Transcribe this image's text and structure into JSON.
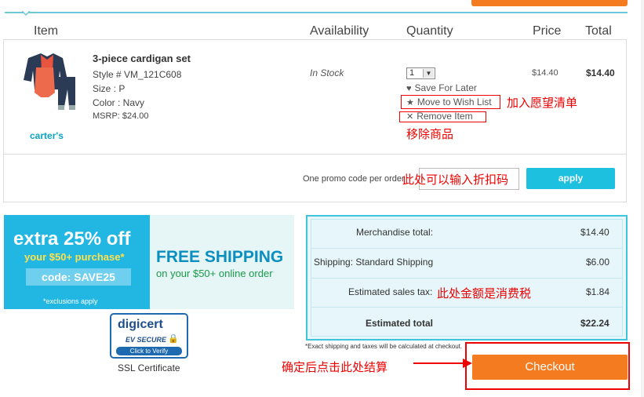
{
  "table_headers": {
    "item": "Item",
    "availability": "Availability",
    "quantity": "Quantity",
    "price": "Price",
    "total": "Total"
  },
  "product": {
    "brand": "carter's",
    "name": "3-piece cardigan set",
    "style": "Style # VM_121C608",
    "size": "Size : P",
    "color": "Color : Navy",
    "msrp": "MSRP: $24.00",
    "availability": "In Stock",
    "quantity": "1",
    "price": "$14.40",
    "total": "$14.40"
  },
  "actions": {
    "save_for_later": "Save For Later",
    "move_to_wish_list": "Move to Wish List",
    "remove_item": "Remove Item"
  },
  "annotations": {
    "wish_list": "加入愿望清单",
    "remove": "移除商品",
    "promo": "此处可以输入折扣码",
    "tax": "此处金额是消费税",
    "checkout": "确定后点击此处结算"
  },
  "promo": {
    "label": "One promo code per order",
    "apply_label": "apply"
  },
  "banner": {
    "extra_title": "extra 25% off",
    "extra_sub": "your $50+ purchase*",
    "code": "code: SAVE25",
    "exclusions": "*exclusions apply",
    "free_title": "FREE SHIPPING",
    "free_sub": "on your $50+ online order"
  },
  "security": {
    "logo_text": "digicert",
    "ev_secure": "EV SECURE",
    "verify": "Click to Verify",
    "caption": "SSL Certificate"
  },
  "summary": {
    "merch_label": "Merchandise total:",
    "merch_value": "$14.40",
    "ship_label": "Shipping: Standard Shipping",
    "ship_value": "$6.00",
    "tax_label": "Estimated sales tax:",
    "tax_value": "$1.84",
    "total_label": "Estimated total",
    "total_value": "$22.24",
    "note": "*Exact shipping and taxes will be calculated at checkout."
  },
  "checkout_label": "Checkout",
  "colors": {
    "accent": "#1ec0e0",
    "checkout": "#f47b20",
    "annotation": "#ee0000"
  }
}
